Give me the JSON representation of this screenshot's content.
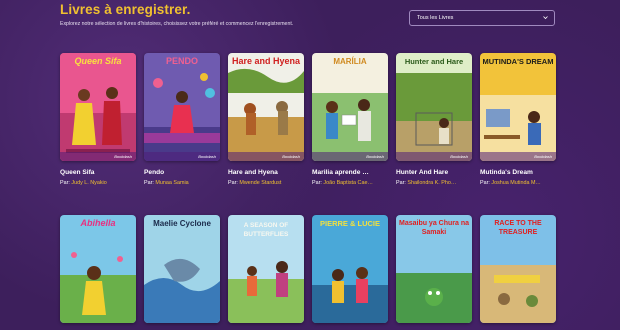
{
  "header": {
    "title": "Livres à enregistrer.",
    "subtitle": "Explorez notre sélection de livres d'histoires, choisissez votre préféré et commencez l'enregistrement."
  },
  "filter": {
    "selected": "Tous les Livres"
  },
  "author_prefix": "Par:",
  "cover_brand": "Bookdash",
  "books": [
    {
      "title": "Queen Sifa",
      "author": "Judy L. Nyakio",
      "cover_title": "Queen Sifa",
      "cover_color": "#e9568f"
    },
    {
      "title": "Pendo",
      "author": "Munaa Samia",
      "cover_title": "PENDO",
      "cover_color": "#6f5bb0"
    },
    {
      "title": "Hare and Hyena",
      "author": "Mwende Stardust",
      "cover_title": "Hare and Hyena",
      "cover_color": "#6a9a3a"
    },
    {
      "title": "Marilia aprende …",
      "author": "João Baptista Cae…",
      "cover_title": "MARÍLIA",
      "cover_color": "#8bc070"
    },
    {
      "title": "Hunter And Hare",
      "author": "Shailondra K. Pho…",
      "cover_title": "Hunter and Hare",
      "cover_color": "#8fb86a"
    },
    {
      "title": "Mutinda's Dream",
      "author": "Joshua Mutinda M…",
      "cover_title": "MUTINDA'S DREAM",
      "cover_color": "#f2c33a"
    },
    {
      "title": "",
      "author": "",
      "cover_title": "Abihella",
      "cover_color": "#7cc7e8"
    },
    {
      "title": "",
      "author": "",
      "cover_title": "Maelie Cyclone",
      "cover_color": "#9fd4e8"
    },
    {
      "title": "",
      "author": "",
      "cover_title": "A SEASON OF BUTTERFLIES",
      "cover_color": "#b7dff0"
    },
    {
      "title": "",
      "author": "",
      "cover_title": "PIERRE & LUCIE",
      "cover_color": "#4aa8d8"
    },
    {
      "title": "",
      "author": "",
      "cover_title": "Masaibu ya Chura na Samaki",
      "cover_color": "#88c8e8"
    },
    {
      "title": "",
      "author": "",
      "cover_title": "RACE TO THE TREASURE",
      "cover_color": "#7ec0e8"
    }
  ]
}
